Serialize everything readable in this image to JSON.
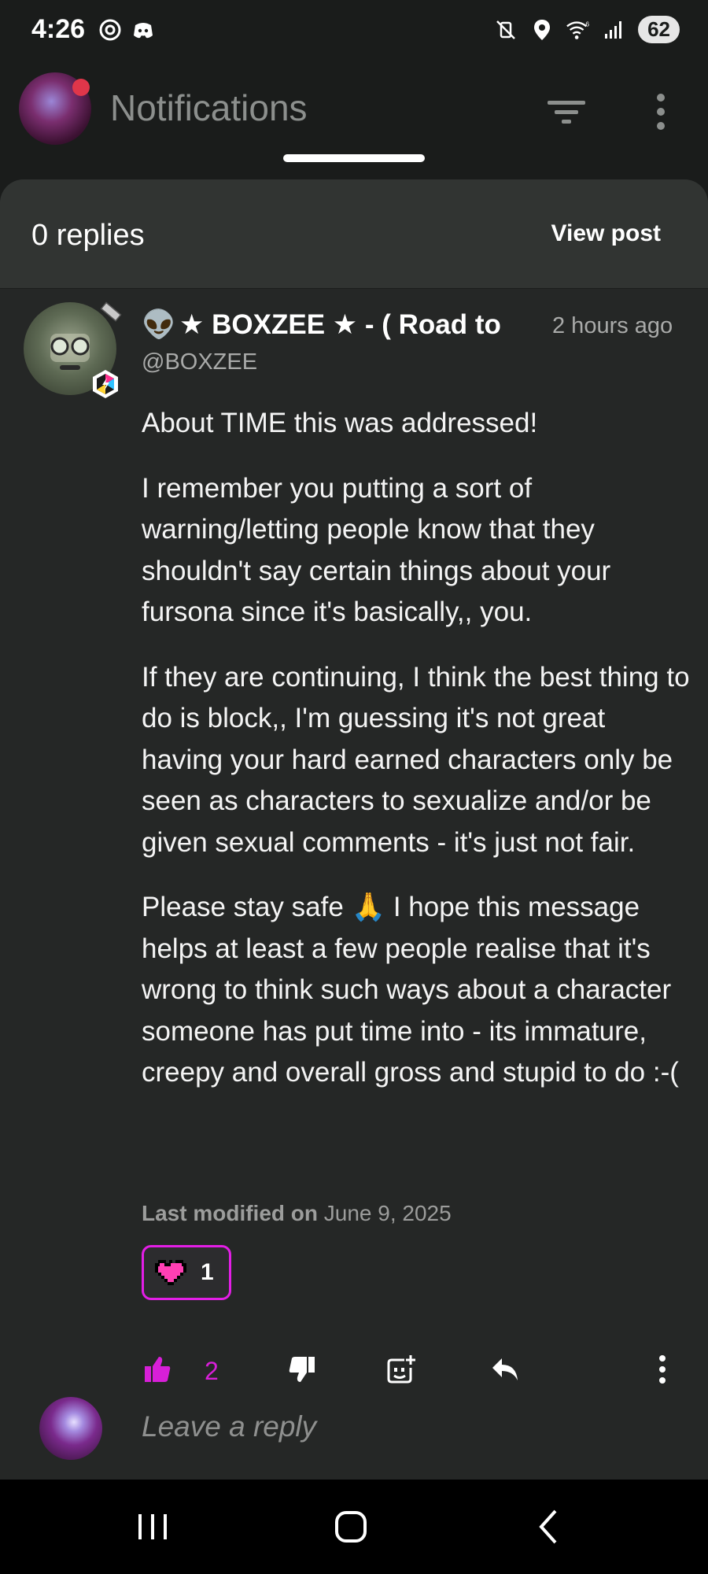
{
  "status_bar": {
    "time": "4:26",
    "battery": "62",
    "left_icons": [
      "threads-icon",
      "discord-icon"
    ],
    "right_icons": [
      "mute-vibrate-icon",
      "location-icon",
      "wifi-6-icon",
      "signal-icon",
      "battery-icon"
    ]
  },
  "app_bar": {
    "title": "Notifications",
    "icons": [
      "avatar",
      "filter-icon",
      "more-vert-icon"
    ]
  },
  "sheet": {
    "replies_count": "0 replies",
    "view_post_label": "View post"
  },
  "comment": {
    "author_emoji": "👽",
    "author_name": "★ BOXZEE ★ - ( Road to",
    "handle": "@BOXZEE",
    "timestamp": "2 hours ago",
    "paragraphs": [
      "About TIME this was addressed!",
      "I remember you putting a sort of warning/letting people know that they shouldn't say certain things about your fursona since it's basically,, you.",
      "If they are continuing, I think the best thing to do is block,, I'm guessing it's not great having your hard earned characters only be seen as characters to sexualize and/or be given sexual comments - it's just not fair.",
      "Please stay safe 🙏 I hope this message helps at least a few people realise that it's wrong to think such ways about a character someone has put time into - its immature, creepy and overall gross and stupid to do :-("
    ],
    "modified_label": "Last modified on",
    "modified_date": "June 9, 2025",
    "reaction_count": "1",
    "upvote_count": "2"
  },
  "reply": {
    "placeholder": "Leave a reply"
  },
  "colors": {
    "accent": "#d81fd8",
    "background": "#252726",
    "header": "#313432"
  }
}
